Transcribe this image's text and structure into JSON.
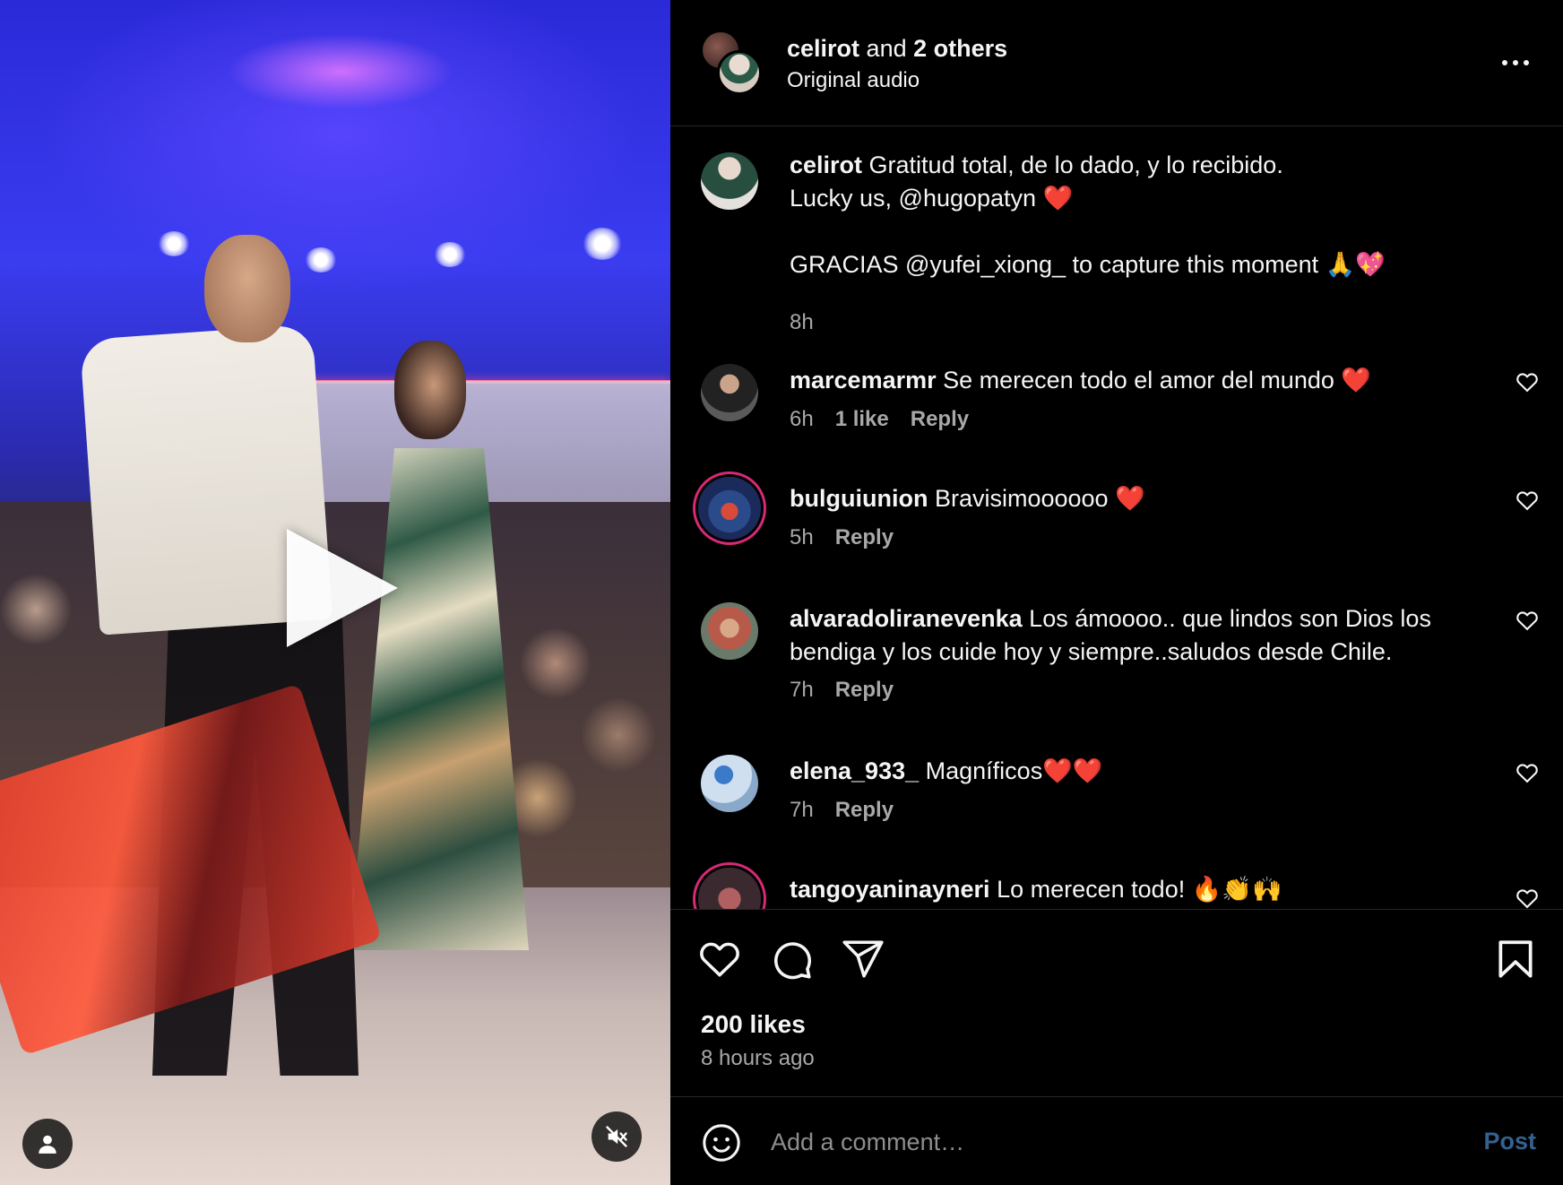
{
  "video": {
    "play_icon": "play-icon",
    "user_icon": "user-icon",
    "mute_icon": "speaker-muted-icon"
  },
  "header": {
    "owner": "celirot",
    "and_text": "and",
    "others": "2 others",
    "audio": "Original audio",
    "more_icon": "more-horizontal-icon"
  },
  "caption": {
    "username": "celirot",
    "line1": "Gratitud total, de lo dado, y lo recibido.",
    "line2": "Lucky us, @hugopatyn ❤️",
    "line3": "GRACIAS @yufei_xiong_ to capture this moment 🙏💖",
    "time": "8h"
  },
  "comments": [
    {
      "username": "marcemarmr",
      "text": "Se merecen todo el amor del mundo ❤️",
      "time": "6h",
      "likes": "1 like",
      "reply": "Reply"
    },
    {
      "username": "bulguiunion",
      "text": "Bravisimoooooo ❤️",
      "time": "5h",
      "likes": "",
      "reply": "Reply"
    },
    {
      "username": "alvaradoliranevenka",
      "text": "Los ámoooo.. que lindos son Dios los bendiga y los cuide hoy y siempre..saludos desde Chile.",
      "time": "7h",
      "likes": "",
      "reply": "Reply"
    },
    {
      "username": "elena_933_",
      "text": "Magníficos❤️❤️",
      "time": "7h",
      "likes": "",
      "reply": "Reply"
    },
    {
      "username": "tangoyaninayneri",
      "text": "Lo merecen todo! 🔥👏🙌",
      "time": "",
      "likes": "",
      "reply": ""
    }
  ],
  "actions": {
    "like_icon": "heart-icon",
    "comment_icon": "comment-icon",
    "share_icon": "share-icon",
    "save_icon": "bookmark-icon",
    "likes": "200 likes",
    "posted": "8 hours ago"
  },
  "composer": {
    "emoji_icon": "emoji-icon",
    "placeholder": "Add a comment…",
    "post_label": "Post"
  },
  "colors": {
    "background": "#000000",
    "text": "#f5f5f5",
    "muted": "#a8a8a8",
    "post_disabled": "#35618f",
    "story_ring": "#d62976"
  }
}
